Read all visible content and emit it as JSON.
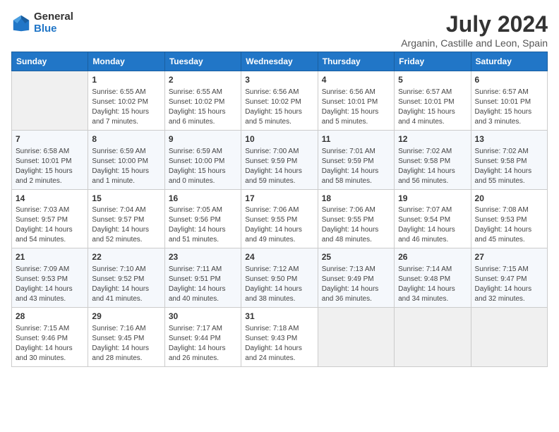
{
  "header": {
    "logo_line1": "General",
    "logo_line2": "Blue",
    "month_year": "July 2024",
    "location": "Arganin, Castille and Leon, Spain"
  },
  "days_of_week": [
    "Sunday",
    "Monday",
    "Tuesday",
    "Wednesday",
    "Thursday",
    "Friday",
    "Saturday"
  ],
  "weeks": [
    [
      {
        "day": "",
        "info": ""
      },
      {
        "day": "1",
        "info": "Sunrise: 6:55 AM\nSunset: 10:02 PM\nDaylight: 15 hours\nand 7 minutes."
      },
      {
        "day": "2",
        "info": "Sunrise: 6:55 AM\nSunset: 10:02 PM\nDaylight: 15 hours\nand 6 minutes."
      },
      {
        "day": "3",
        "info": "Sunrise: 6:56 AM\nSunset: 10:02 PM\nDaylight: 15 hours\nand 5 minutes."
      },
      {
        "day": "4",
        "info": "Sunrise: 6:56 AM\nSunset: 10:01 PM\nDaylight: 15 hours\nand 5 minutes."
      },
      {
        "day": "5",
        "info": "Sunrise: 6:57 AM\nSunset: 10:01 PM\nDaylight: 15 hours\nand 4 minutes."
      },
      {
        "day": "6",
        "info": "Sunrise: 6:57 AM\nSunset: 10:01 PM\nDaylight: 15 hours\nand 3 minutes."
      }
    ],
    [
      {
        "day": "7",
        "info": "Sunrise: 6:58 AM\nSunset: 10:01 PM\nDaylight: 15 hours\nand 2 minutes."
      },
      {
        "day": "8",
        "info": "Sunrise: 6:59 AM\nSunset: 10:00 PM\nDaylight: 15 hours\nand 1 minute."
      },
      {
        "day": "9",
        "info": "Sunrise: 6:59 AM\nSunset: 10:00 PM\nDaylight: 15 hours\nand 0 minutes."
      },
      {
        "day": "10",
        "info": "Sunrise: 7:00 AM\nSunset: 9:59 PM\nDaylight: 14 hours\nand 59 minutes."
      },
      {
        "day": "11",
        "info": "Sunrise: 7:01 AM\nSunset: 9:59 PM\nDaylight: 14 hours\nand 58 minutes."
      },
      {
        "day": "12",
        "info": "Sunrise: 7:02 AM\nSunset: 9:58 PM\nDaylight: 14 hours\nand 56 minutes."
      },
      {
        "day": "13",
        "info": "Sunrise: 7:02 AM\nSunset: 9:58 PM\nDaylight: 14 hours\nand 55 minutes."
      }
    ],
    [
      {
        "day": "14",
        "info": "Sunrise: 7:03 AM\nSunset: 9:57 PM\nDaylight: 14 hours\nand 54 minutes."
      },
      {
        "day": "15",
        "info": "Sunrise: 7:04 AM\nSunset: 9:57 PM\nDaylight: 14 hours\nand 52 minutes."
      },
      {
        "day": "16",
        "info": "Sunrise: 7:05 AM\nSunset: 9:56 PM\nDaylight: 14 hours\nand 51 minutes."
      },
      {
        "day": "17",
        "info": "Sunrise: 7:06 AM\nSunset: 9:55 PM\nDaylight: 14 hours\nand 49 minutes."
      },
      {
        "day": "18",
        "info": "Sunrise: 7:06 AM\nSunset: 9:55 PM\nDaylight: 14 hours\nand 48 minutes."
      },
      {
        "day": "19",
        "info": "Sunrise: 7:07 AM\nSunset: 9:54 PM\nDaylight: 14 hours\nand 46 minutes."
      },
      {
        "day": "20",
        "info": "Sunrise: 7:08 AM\nSunset: 9:53 PM\nDaylight: 14 hours\nand 45 minutes."
      }
    ],
    [
      {
        "day": "21",
        "info": "Sunrise: 7:09 AM\nSunset: 9:53 PM\nDaylight: 14 hours\nand 43 minutes."
      },
      {
        "day": "22",
        "info": "Sunrise: 7:10 AM\nSunset: 9:52 PM\nDaylight: 14 hours\nand 41 minutes."
      },
      {
        "day": "23",
        "info": "Sunrise: 7:11 AM\nSunset: 9:51 PM\nDaylight: 14 hours\nand 40 minutes."
      },
      {
        "day": "24",
        "info": "Sunrise: 7:12 AM\nSunset: 9:50 PM\nDaylight: 14 hours\nand 38 minutes."
      },
      {
        "day": "25",
        "info": "Sunrise: 7:13 AM\nSunset: 9:49 PM\nDaylight: 14 hours\nand 36 minutes."
      },
      {
        "day": "26",
        "info": "Sunrise: 7:14 AM\nSunset: 9:48 PM\nDaylight: 14 hours\nand 34 minutes."
      },
      {
        "day": "27",
        "info": "Sunrise: 7:15 AM\nSunset: 9:47 PM\nDaylight: 14 hours\nand 32 minutes."
      }
    ],
    [
      {
        "day": "28",
        "info": "Sunrise: 7:15 AM\nSunset: 9:46 PM\nDaylight: 14 hours\nand 30 minutes."
      },
      {
        "day": "29",
        "info": "Sunrise: 7:16 AM\nSunset: 9:45 PM\nDaylight: 14 hours\nand 28 minutes."
      },
      {
        "day": "30",
        "info": "Sunrise: 7:17 AM\nSunset: 9:44 PM\nDaylight: 14 hours\nand 26 minutes."
      },
      {
        "day": "31",
        "info": "Sunrise: 7:18 AM\nSunset: 9:43 PM\nDaylight: 14 hours\nand 24 minutes."
      },
      {
        "day": "",
        "info": ""
      },
      {
        "day": "",
        "info": ""
      },
      {
        "day": "",
        "info": ""
      }
    ]
  ]
}
